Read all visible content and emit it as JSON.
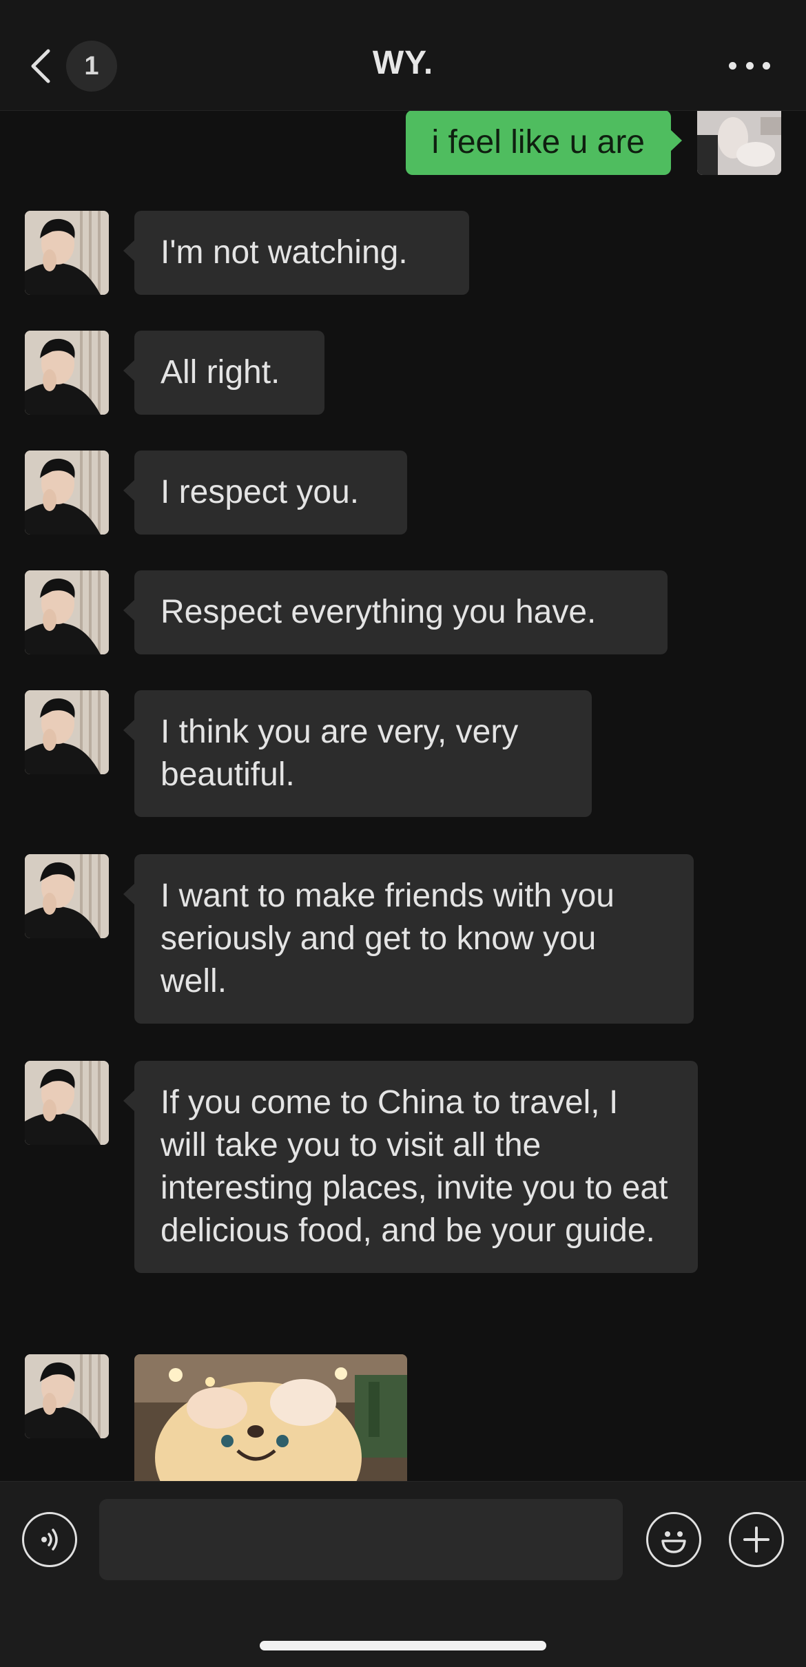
{
  "header": {
    "back_icon": "chevron-left-icon",
    "unread_count": "1",
    "title": "WY.",
    "more_icon": "more-dots-icon"
  },
  "messages": [
    {
      "from": "me",
      "text": "i feel like u are"
    },
    {
      "from": "them",
      "text": "I'm not watching."
    },
    {
      "from": "them",
      "text": "All right."
    },
    {
      "from": "them",
      "text": "I respect you."
    },
    {
      "from": "them",
      "text": "Respect everything you have."
    },
    {
      "from": "them",
      "text": "I think you are very, very beautiful."
    },
    {
      "from": "them",
      "text": "I want to make friends with you seriously and get to know you well."
    },
    {
      "from": "them",
      "text": "If you come to China to travel, I will take you to visit all the interesting places, invite you to eat delicious food, and be your guide."
    },
    {
      "from": "them",
      "type": "image",
      "icon": "plush-toy-photo"
    }
  ],
  "input_bar": {
    "voice_icon": "voice-icon",
    "text_value": "",
    "emoji_icon": "emoji-icon",
    "add_icon": "plus-icon"
  },
  "colors": {
    "background": "#111111",
    "incoming_bubble": "#2c2c2c",
    "outgoing_bubble": "#4fbd5f",
    "text": "#e4e4e4"
  }
}
